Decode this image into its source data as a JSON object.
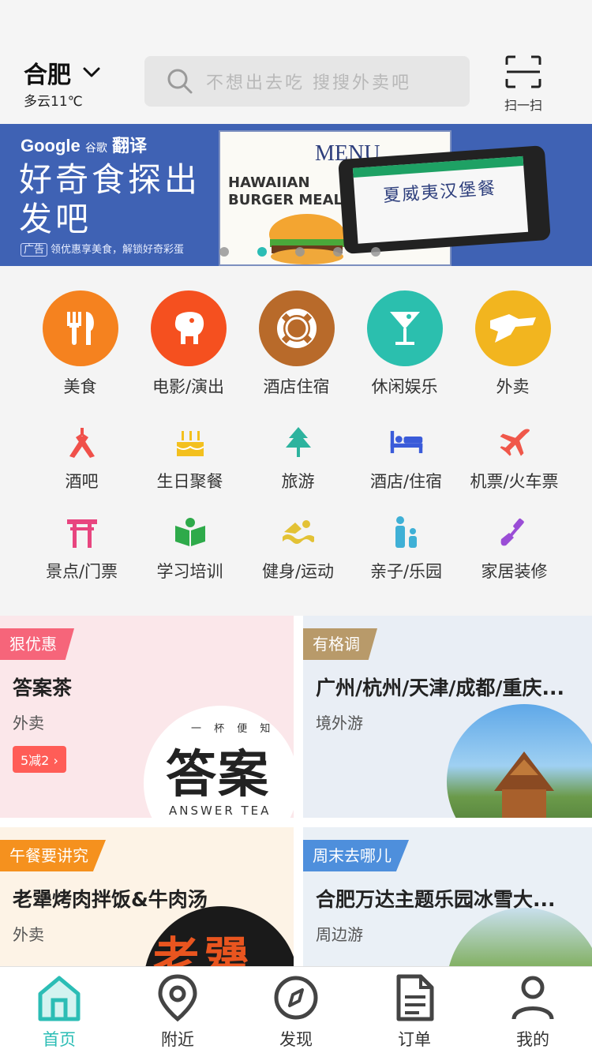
{
  "header": {
    "city": "合肥",
    "weather": "多云11℃",
    "search_placeholder": "不想出去吃  搜搜外卖吧",
    "scan_label": "扫一扫"
  },
  "banner": {
    "brand": "Google",
    "brand_cn": "谷歌",
    "brand_product": "翻译",
    "slogan": "好奇食探出发吧",
    "ad_badge": "广告",
    "subtitle": "领优惠享美食，解锁好奇彩蛋",
    "menu_title": "MENU",
    "meal_en": "HAWAIIAN BURGER MEAL",
    "meal_cn": "夏威夷汉堡餐",
    "dot_count": 5,
    "active_dot": 1
  },
  "categories_big": [
    {
      "label": "美食",
      "icon": "fork-knife-icon",
      "color": "#f5821f"
    },
    {
      "label": "电影/演出",
      "icon": "elephant-icon",
      "color": "#f5501f"
    },
    {
      "label": "酒店住宿",
      "icon": "lifebuoy-icon",
      "color": "#b86a2a"
    },
    {
      "label": "休闲娱乐",
      "icon": "cocktail-icon",
      "color": "#2bbfae"
    },
    {
      "label": "外卖",
      "icon": "delivery-icon",
      "color": "#f2b51f"
    }
  ],
  "categories_small_1": [
    {
      "label": "酒吧",
      "icon": "bar-icon",
      "color": "#f0504a"
    },
    {
      "label": "生日聚餐",
      "icon": "cake-icon",
      "color": "#f3c01e"
    },
    {
      "label": "旅游",
      "icon": "tree-icon",
      "color": "#2db39e"
    },
    {
      "label": "酒店/住宿",
      "icon": "bed-icon",
      "color": "#3a5bd9"
    },
    {
      "label": "机票/火车票",
      "icon": "plane-icon",
      "color": "#f0574a"
    }
  ],
  "categories_small_2": [
    {
      "label": "景点/门票",
      "icon": "torii-icon",
      "color": "#e8457f"
    },
    {
      "label": "学习培训",
      "icon": "book-icon",
      "color": "#2eaa4a"
    },
    {
      "label": "健身/运动",
      "icon": "swim-icon",
      "color": "#e3c235"
    },
    {
      "label": "亲子/乐园",
      "icon": "family-icon",
      "color": "#3fb0d6"
    },
    {
      "label": "家居装修",
      "icon": "shovel-icon",
      "color": "#9a4dd6"
    }
  ],
  "cards": [
    {
      "tag": "狠优惠",
      "tag_color": "#f6657a",
      "title": "答案茶",
      "category": "外卖",
      "promo": "5减2 ›",
      "logo_top": "一 杯 便 知",
      "logo_main": "答案",
      "logo_en": "ANSWER TEA"
    },
    {
      "tag": "有格调",
      "tag_color": "#b89a6a",
      "title": "广州/杭州/天津/成都/重庆...",
      "category": "境外游"
    },
    {
      "tag": "午餐要讲究",
      "tag_color": "#f5911e",
      "title": "老犟烤肉拌饭&牛肉汤",
      "category": "外卖",
      "logo_main": "老犟"
    },
    {
      "tag": "周末去哪儿",
      "tag_color": "#4e8fdc",
      "title": "合肥万达主题乐园冰雪大...",
      "category": "周边游"
    }
  ],
  "tabs": [
    {
      "label": "首页",
      "icon": "home-icon",
      "active": true
    },
    {
      "label": "附近",
      "icon": "location-pin-icon"
    },
    {
      "label": "发现",
      "icon": "compass-icon"
    },
    {
      "label": "订单",
      "icon": "document-icon"
    },
    {
      "label": "我的",
      "icon": "user-icon"
    }
  ],
  "colors": {
    "accent": "#2bbdb5",
    "banner_bg": "#3f62b4"
  }
}
